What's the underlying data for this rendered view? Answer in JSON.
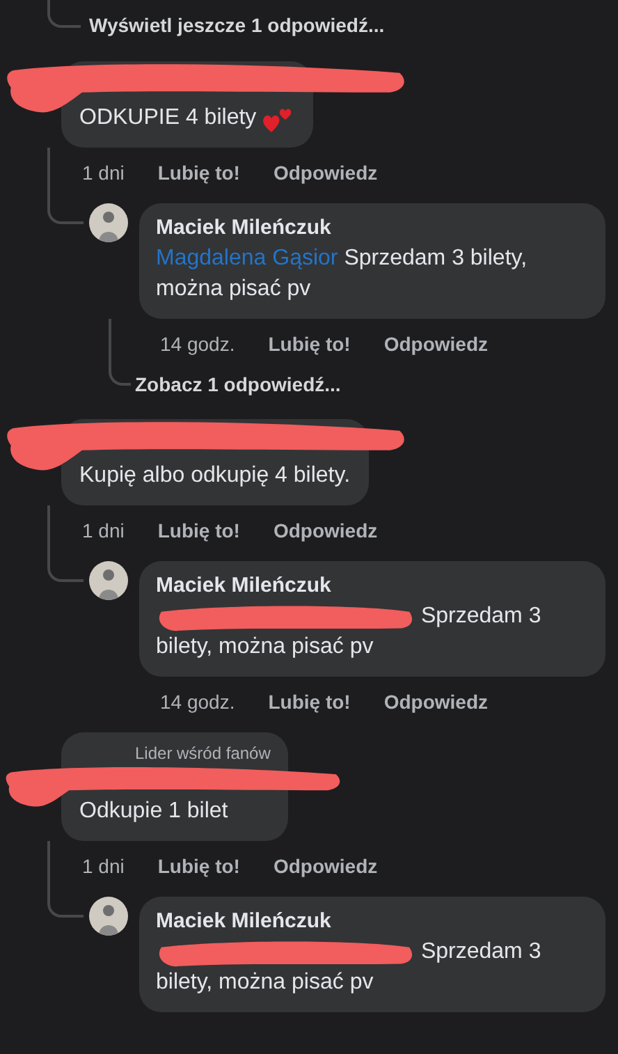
{
  "more_replies_link": "Wyświetl jeszcze 1 odpowiedź...",
  "threads": [
    {
      "comment": {
        "author_redacted": true,
        "text": "ODKUPIE 4 bilety",
        "hearts": true,
        "time": "1 dni",
        "like": "Lubię to!",
        "reply": "Odpowiedz"
      },
      "reply": {
        "author": "Maciek Mileńczuk",
        "mention": {
          "redacted": false,
          "text": "Magdalena Gąsior"
        },
        "text": "Sprzedam 3 bilety, można pisać pv",
        "time": "14 godz.",
        "like": "Lubię to!",
        "reply": "Odpowiedz"
      },
      "more_link": "Zobacz 1 odpowiedź..."
    },
    {
      "comment": {
        "author_redacted": true,
        "text": "Kupię albo odkupię 4 bilety.",
        "hearts": false,
        "time": "1 dni",
        "like": "Lubię to!",
        "reply": "Odpowiedz"
      },
      "reply": {
        "author": "Maciek Mileńczuk",
        "mention": {
          "redacted": true
        },
        "text": "Sprzedam 3 bilety, można pisać pv",
        "time": "14 godz.",
        "like": "Lubię to!",
        "reply": "Odpowiedz"
      }
    },
    {
      "comment": {
        "author_redacted": true,
        "badge": "Lider wśród fanów",
        "text": "Odkupie 1 bilet",
        "hearts": false,
        "time": "1 dni",
        "like": "Lubię to!",
        "reply": "Odpowiedz"
      },
      "reply": {
        "author": "Maciek Mileńczuk",
        "mention": {
          "redacted": true
        },
        "text": "Sprzedam 3 bilety, można pisać pv"
      }
    }
  ]
}
